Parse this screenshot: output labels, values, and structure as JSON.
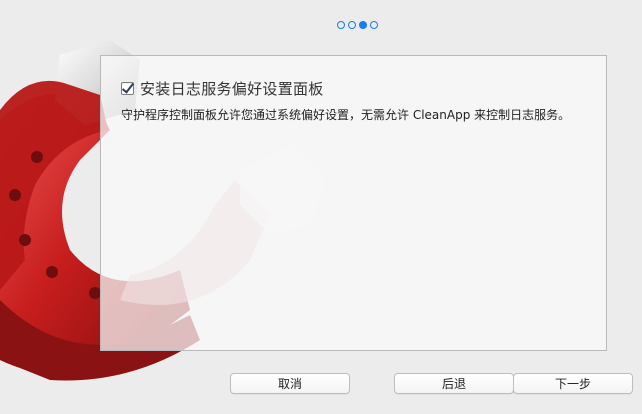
{
  "pagination": {
    "count": 4,
    "active_index": 2,
    "accent_color": "#1a7cf0"
  },
  "illustration": {
    "icon": "magnet-icon",
    "colors": [
      "#c81e1e",
      "#e8e8e8"
    ]
  },
  "option": {
    "checked": true,
    "label": "安装日志服务偏好设置面板"
  },
  "description": "守护程序控制面板允许您通过系统偏好设置，无需允许 CleanApp 来控制日志服务。",
  "buttons": {
    "cancel": "取消",
    "back": "后退",
    "next": "下一步"
  }
}
